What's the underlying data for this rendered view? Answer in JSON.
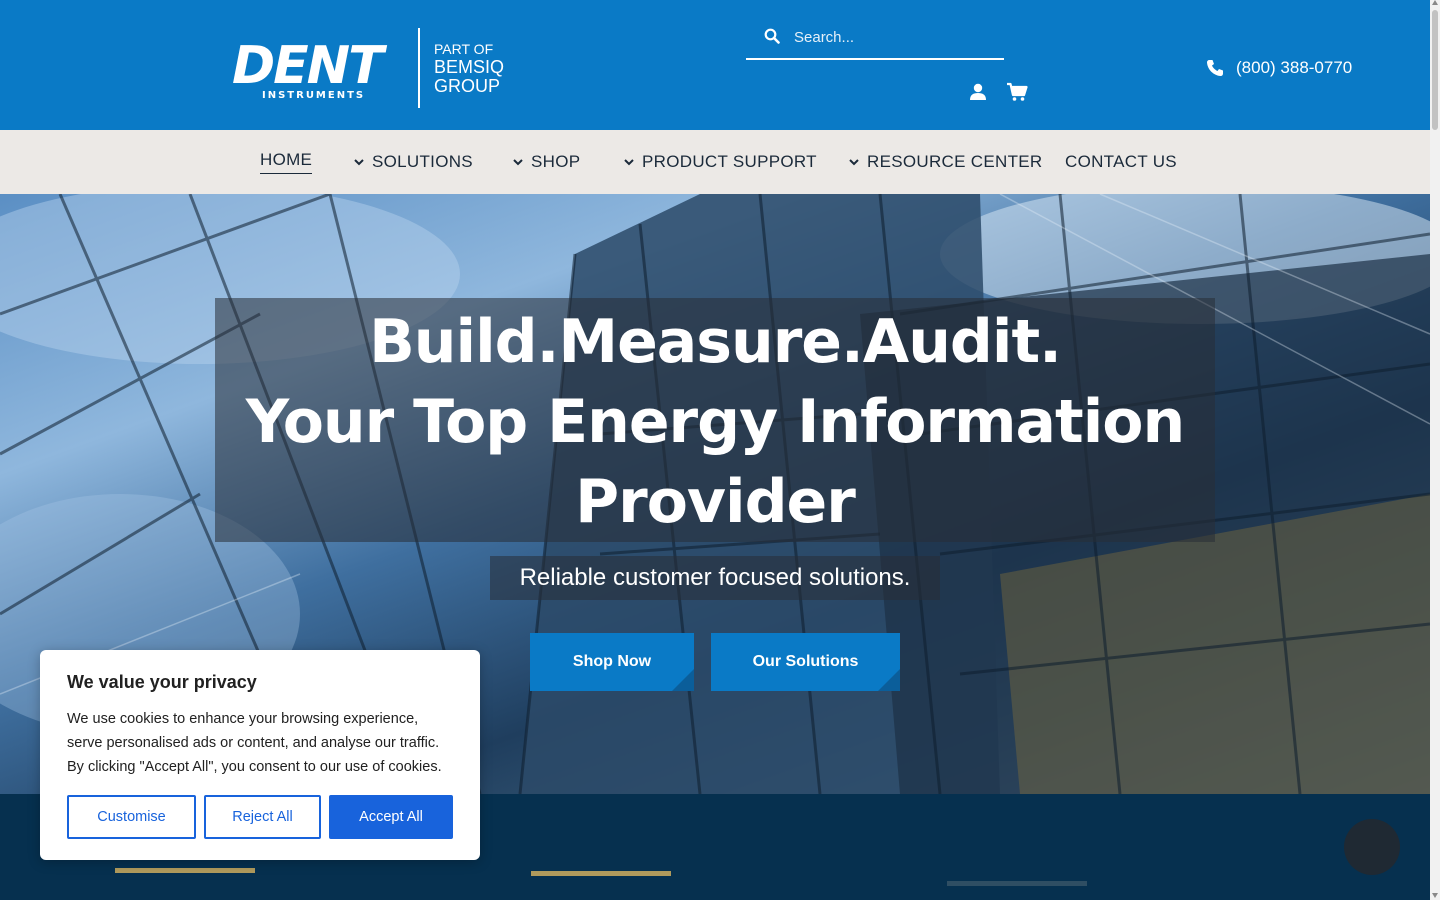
{
  "header": {
    "logo_main": "DENT",
    "logo_sub": "INSTRUMENTS",
    "logo_part_of": "PART OF",
    "logo_group_1": "BEMSIQ",
    "logo_group_2": "GROUP",
    "search_placeholder": "Search...",
    "phone": "(800) 388-0770"
  },
  "nav": {
    "items": [
      {
        "label": "HOME",
        "dropdown": false,
        "active": true
      },
      {
        "label": "SOLUTIONS",
        "dropdown": true
      },
      {
        "label": "SHOP",
        "dropdown": true
      },
      {
        "label": "PRODUCT SUPPORT",
        "dropdown": true
      },
      {
        "label": "RESOURCE CENTER",
        "dropdown": true
      },
      {
        "label": "CONTACT US",
        "dropdown": false
      }
    ]
  },
  "hero": {
    "title_line1": "Build.Measure.Audit.",
    "title_line2": "Your Top Energy Information",
    "title_line3": "Provider",
    "subtitle": "Reliable customer focused solutions.",
    "btn_shop": "Shop Now",
    "btn_solutions": "Our Solutions"
  },
  "cookie": {
    "title": "We value your privacy",
    "text": "We use cookies to enhance your browsing experience, serve personalised ads or content, and analyse our traffic. By clicking \"Accept All\", you consent to our use of cookies.",
    "btn_customise": "Customise",
    "btn_reject": "Reject All",
    "btn_accept": "Accept All"
  },
  "colors": {
    "brand_blue": "#0a7ac6",
    "nav_bg": "#ece9e6",
    "band_bg": "#06304f",
    "gold_accent": "#b09a5c",
    "cookie_blue": "#1863dc"
  }
}
